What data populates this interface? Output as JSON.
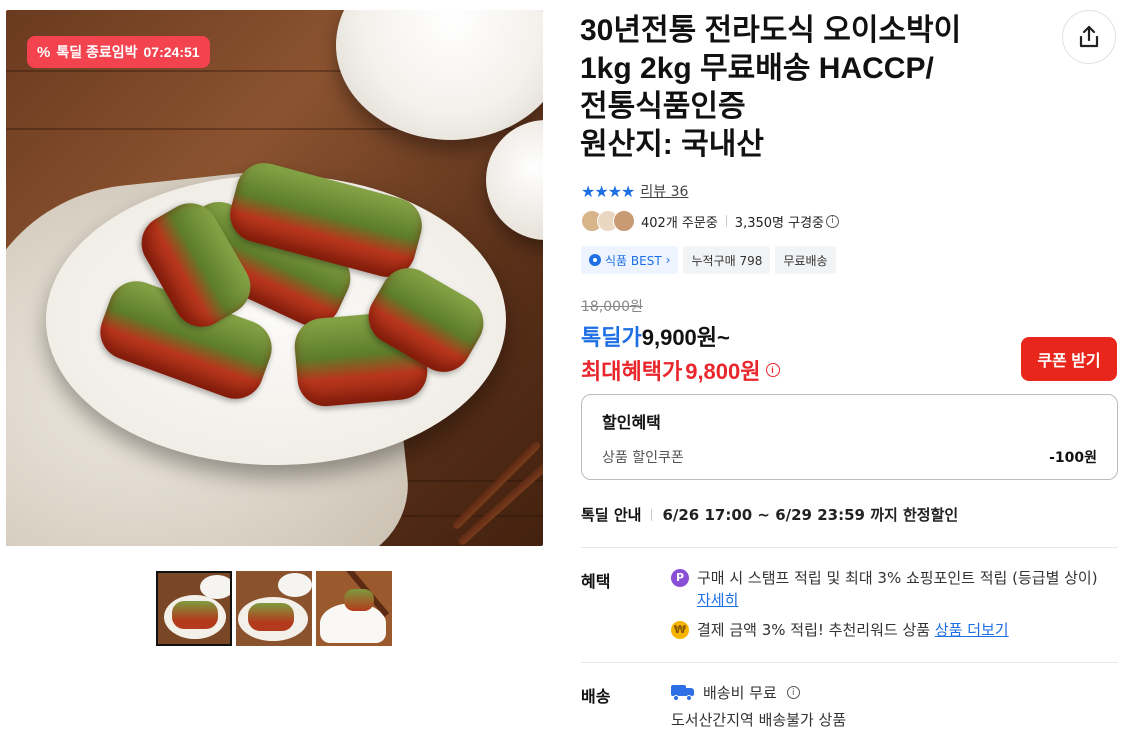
{
  "deal_badge": {
    "label": "톡딜 종료임박",
    "timer": "07:24:51"
  },
  "product": {
    "title_lines": [
      "30년전통 전라도식 오이소박이",
      "1kg 2kg 무료배송 HACCP/",
      "전통식품인증",
      "원산지: 국내산"
    ],
    "rating_stars": 4,
    "review_label": "리뷰 36",
    "orders": "402개 주문중",
    "watching": "3,350명 구경중",
    "tags": [
      {
        "label": "식품 BEST",
        "suffix": "›",
        "style": "best"
      },
      {
        "label": "누적구매 798",
        "style": "plain"
      },
      {
        "label": "무료배송",
        "style": "plain"
      }
    ]
  },
  "price": {
    "original": "18,000원",
    "deal_label": "톡딜가",
    "deal_amount": "9,900원~",
    "max_label": "최대혜택가",
    "max_amount": "9,800원",
    "coupon_button": "쿠폰 받기"
  },
  "discount": {
    "heading": "할인혜택",
    "item_label": "상품 할인쿠폰",
    "item_value": "-100원"
  },
  "deal_info": {
    "label": "톡딜 안내",
    "value": "6/26 17:00 ~ 6/29 23:59 까지 한정할인"
  },
  "benefits": {
    "label": "혜택",
    "line1_text": "구매 시 스탬프 적립 및 최대 3% 쇼핑포인트 적립 (등급별 상이)",
    "line1_link": "자세히",
    "line2_text": "결제 금액 3% 적립! 추천리워드 상품",
    "line2_link": "상품 더보기"
  },
  "shipping": {
    "label": "배송",
    "fee": "배송비 무료",
    "note": "도서산간지역 배송불가 상품"
  },
  "icons": {
    "share": "share-icon",
    "percent": "percent-icon",
    "star": "star-icon",
    "info": "info-icon",
    "point": "point-icon",
    "reward": "reward-icon",
    "truck": "truck-icon"
  },
  "colors": {
    "accent_blue": "#1e6fe4",
    "deal_red": "#e8262c",
    "badge_red": "#f2434f"
  },
  "thumbnails_count": 3
}
